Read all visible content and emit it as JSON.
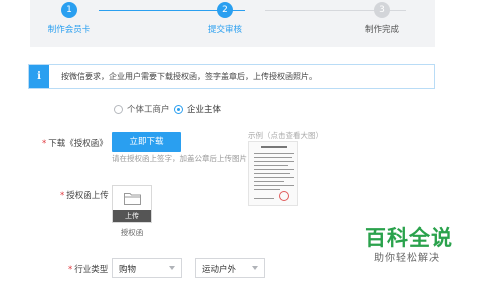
{
  "stepper": {
    "steps": [
      {
        "number": "1",
        "label": "制作会员卡",
        "state": "completed"
      },
      {
        "number": "2",
        "label": "提交审核",
        "state": "active"
      },
      {
        "number": "3",
        "label": "制作完成",
        "state": "pending"
      }
    ]
  },
  "notice": {
    "icon": "info-icon",
    "icon_glyph": "i",
    "text": "按微信要求，企业用户需要下载授权函，签字盖章后，上传授权函照片。"
  },
  "entity_type": {
    "options": [
      {
        "label": "个体工商户",
        "selected": false
      },
      {
        "label": "企业主体",
        "selected": true
      }
    ]
  },
  "download": {
    "label": "下载《授权函》",
    "button": "立即下载",
    "hint": "请在授权函上签字，加盖公章后上传图片"
  },
  "example": {
    "caption": "示例（点击查看大图）"
  },
  "upload": {
    "label": "授权函上传",
    "button": "上传",
    "caption": "授权函",
    "icon": "folder-icon"
  },
  "industry": {
    "label": "行业类型",
    "primary": "购物",
    "secondary": "运动户外"
  },
  "watermark": {
    "title": "百科全说",
    "subtitle": "助你轻松解决"
  },
  "colors": {
    "accent": "#2a9ff0",
    "required": "#e0373d",
    "watermark": "#2aa24c"
  }
}
